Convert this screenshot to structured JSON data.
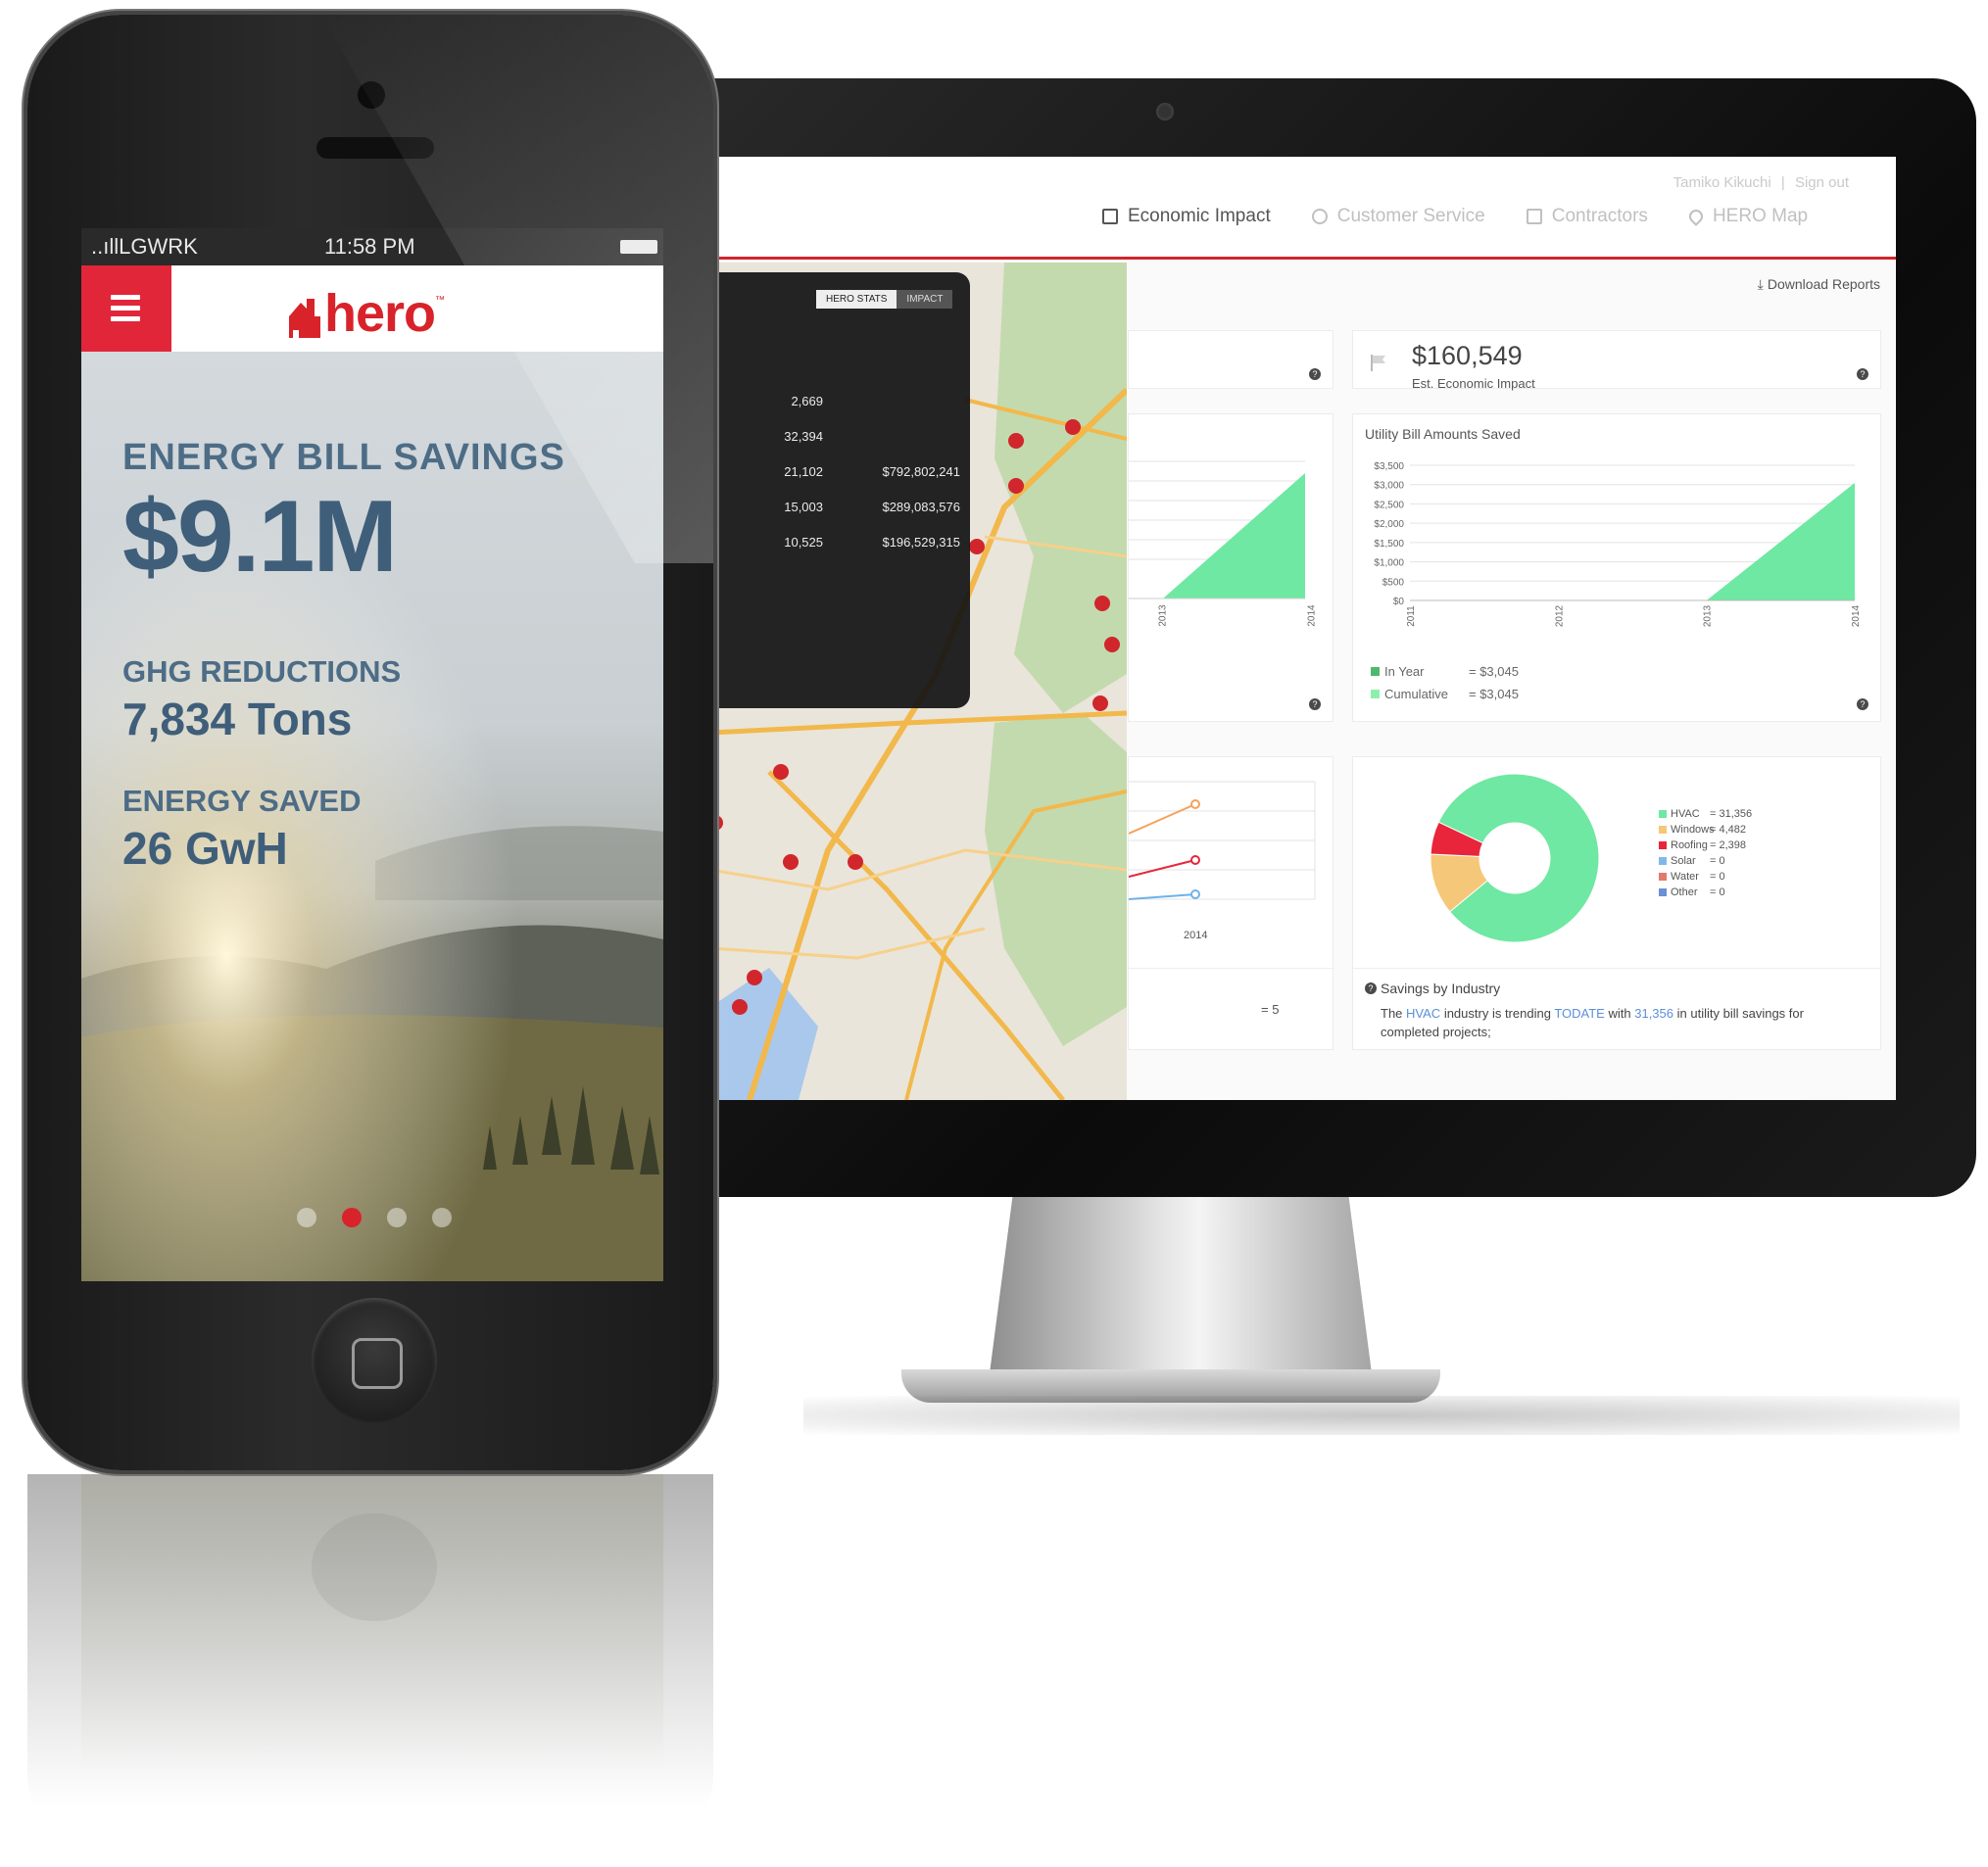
{
  "phone": {
    "carrier": "..ıllLGWRK",
    "time": "11:58 PM",
    "logo": "hero",
    "logo_tm": "™",
    "energy_bill_savings_label": "ENERGY BILL SAVINGS",
    "energy_bill_savings_value": "$9.1M",
    "ghg_label": "GHG REDUCTIONS",
    "ghg_value": "7,834 Tons",
    "energy_saved_label": "ENERGY SAVED",
    "energy_saved_value": "26 GwH",
    "carousel_active_index": 1,
    "carousel_count": 4
  },
  "dashboard": {
    "user_name": "Tamiko Kikuchi",
    "separator": "|",
    "sign_out": "Sign out",
    "nav": [
      {
        "label": "Economic Impact",
        "active": true
      },
      {
        "label": "Customer Service",
        "active": false
      },
      {
        "label": "Contractors",
        "active": false
      },
      {
        "label": "HERO Map",
        "active": false
      }
    ],
    "download_reports": "Download Reports",
    "map_tabs": [
      "HERO STATS",
      "IMPACT"
    ],
    "map_stats": [
      {
        "a": "2,669",
        "b": ""
      },
      {
        "a": "32,394",
        "b": ""
      },
      {
        "a": "21,102",
        "b": "$792,802,241"
      },
      {
        "a": "15,003",
        "b": "$289,083,576"
      },
      {
        "a": "10,525",
        "b": "$196,529,315"
      }
    ],
    "kpi": {
      "value": "$160,549",
      "label": "Est. Economic Impact"
    },
    "help_glyph": "?",
    "utility_chart": {
      "title": "Utility Bill Amounts Saved",
      "legend": [
        {
          "label": "In Year",
          "value": "= $3,045"
        },
        {
          "label": "Cumulative",
          "value": "= $3,045"
        }
      ]
    },
    "industry": {
      "legend": [
        {
          "label": "HVAC",
          "value": "= 31,356"
        },
        {
          "label": "Windows",
          "value": "= 4,482"
        },
        {
          "label": "Roofing",
          "value": "= 2,398"
        },
        {
          "label": "Solar",
          "value": "= 0"
        },
        {
          "label": "Water",
          "value": "= 0"
        },
        {
          "label": "Other",
          "value": "= 0"
        }
      ],
      "title": "Savings by Industry",
      "text_1": "The",
      "text_hvac": "HVAC",
      "text_2": "industry is trending",
      "text_todate": "TODATE",
      "text_3": "with",
      "text_amount": "31,356",
      "text_4": "in utility bill savings for completed projects;"
    },
    "partial_cards": {
      "left_axis_labels": [
        "2013",
        "2014"
      ],
      "line_chart_x": "2014",
      "line_value": "= 5"
    }
  },
  "chart_data": [
    {
      "type": "area",
      "title": "Utility Bill Amounts Saved",
      "x": [
        "2011",
        "2012",
        "2013",
        "2014"
      ],
      "series": [
        {
          "name": "Cumulative",
          "values": [
            0,
            0,
            0,
            3045
          ]
        }
      ],
      "ylim": [
        0,
        3500
      ],
      "yticks": [
        "$0",
        "$500",
        "$1,000",
        "$1,500",
        "$2,000",
        "$2,500",
        "$3,000",
        "$3,500"
      ],
      "grid": true
    },
    {
      "type": "pie",
      "categories": [
        "HVAC",
        "Windows",
        "Roofing",
        "Solar",
        "Water",
        "Other"
      ],
      "values": [
        31356,
        4482,
        2398,
        0,
        0,
        0
      ],
      "colors": [
        "#6ee8a2",
        "#f5c778",
        "#e8253b",
        "#82b8e8",
        "#e07a6a",
        "#6c8fd6"
      ]
    }
  ],
  "colors": {
    "brand_red": "#d8232a",
    "chart_green": "#6ee8a2",
    "hero_text_blue": "#4d6c86"
  }
}
